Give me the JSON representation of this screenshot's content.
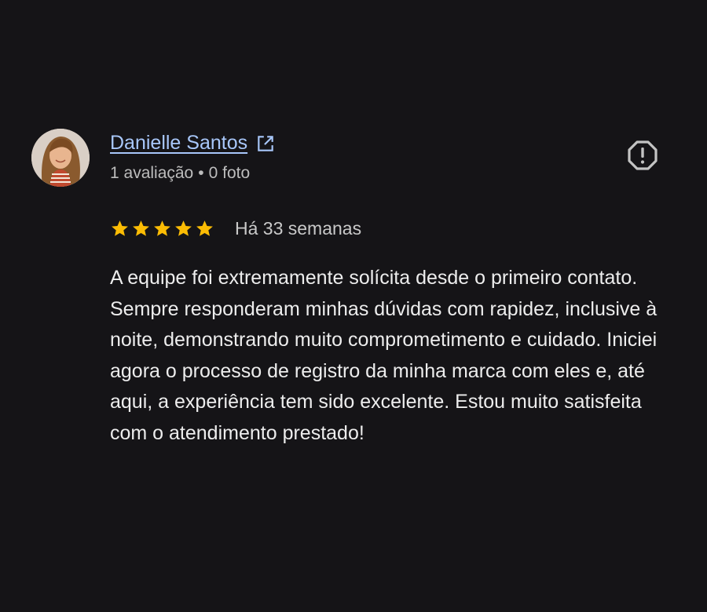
{
  "review": {
    "author": "Danielle Santos",
    "review_count": "1 avaliação",
    "separator": "•",
    "photo_count": "0 foto",
    "rating": 5,
    "max_rating": 5,
    "time_ago": "Há 33 semanas",
    "text": "A equipe foi extremamente solícita desde o primeiro contato. Sempre responderam minhas dúvidas com rapidez, inclusive à noite, demonstrando muito comprometimento e cuidado. Iniciei agora o processo de registro da minha marca com eles e, até aqui, a experiência tem sido excelente. Estou muito satisfeita com o atendimento prestado!"
  },
  "icons": {
    "external_link": "external-link-icon",
    "report": "report-flag-icon",
    "star": "star-icon"
  },
  "colors": {
    "background": "#151417",
    "link": "#a8c7fa",
    "star": "#fbbc04",
    "text": "#ededed",
    "muted": "#bdbdbd"
  }
}
